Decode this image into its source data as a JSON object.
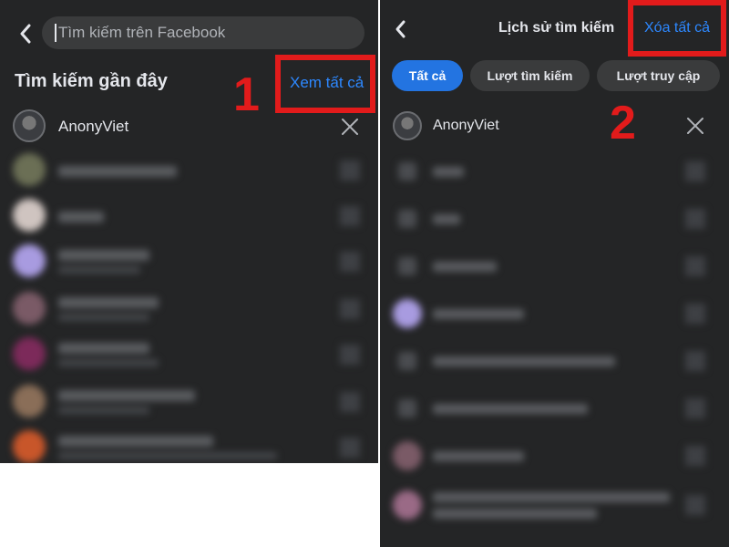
{
  "left": {
    "search_placeholder": "Tìm kiếm trên Facebook",
    "section_title": "Tìm kiếm gần đây",
    "see_all": "Xem tất cả",
    "first_item": "AnonyViet",
    "step_label": "1"
  },
  "right": {
    "title": "Lịch sử tìm kiếm",
    "clear_all": "Xóa tất cả",
    "chips": [
      "Tất cả",
      "Lượt tìm kiếm",
      "Lượt truy cập"
    ],
    "first_item": "AnonyViet",
    "step_label": "2"
  },
  "colors": {
    "background": "#242526",
    "accent": "#2d88ff",
    "highlight": "#e21b1b"
  }
}
